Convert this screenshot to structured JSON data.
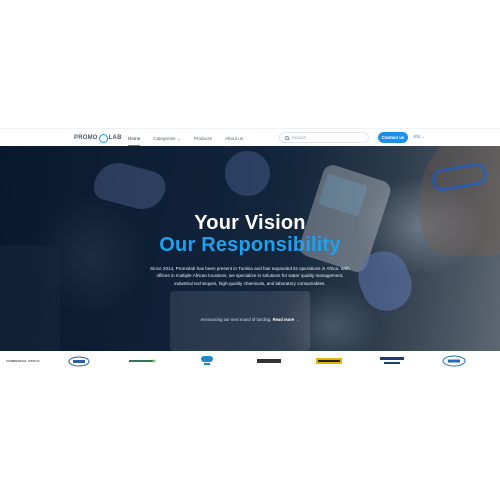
{
  "header": {
    "logo_left": "PROMO",
    "logo_right": "LAB",
    "nav": [
      {
        "label": "Home",
        "active": true
      },
      {
        "label": "Categories",
        "dropdown": true
      },
      {
        "label": "Products"
      },
      {
        "label": "About us"
      }
    ],
    "search_placeholder": "Search",
    "contact_label": "Contact us",
    "lang": "EN"
  },
  "hero": {
    "title_line1": "Your Vision",
    "title_line2": "Our Responsibility",
    "description": "Since 2014, Promolab has been present in Tunisia and has expanded its operations in Africa. With offices in multiple African locations, we specialize in solutions for water quality management, industrial techniques, high-quality chemicals, and laboratory consumables.",
    "announce_text": "Announcing our next round of funding.",
    "read_more": "Read more",
    "arrow": "→"
  },
  "partners": {
    "label": "COMMERCIAL OFFICE",
    "logos": [
      {
        "name": "Gerbo",
        "color": "#2a5fa8"
      },
      {
        "name": "Growsmart",
        "color": "#2e7d4f"
      },
      {
        "name": "Hach",
        "color": "#1e88c8"
      },
      {
        "name": "Hebersel",
        "color": "#333333"
      },
      {
        "name": "LabsTech",
        "color": "#e2b300"
      },
      {
        "name": "RADWAG",
        "color": "#1d3d7a"
      },
      {
        "name": "IKA",
        "color": "#1e6fb8"
      }
    ]
  },
  "colors": {
    "accent": "#1e8fe6",
    "hero_highlight": "#1ea0f0"
  }
}
